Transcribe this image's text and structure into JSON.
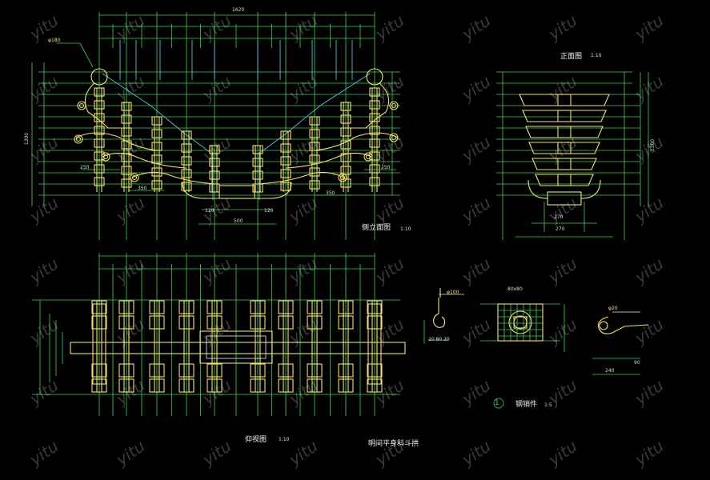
{
  "colors": {
    "background": "#000000",
    "dimension": "#39d353",
    "outline": "#f4e36a",
    "cyan": "#4fc6e0",
    "white_text": "#f2f2f2"
  },
  "labels": {
    "side_elevation_title": "侧立面图",
    "side_elevation_scale": "1:10",
    "front_elevation_title": "正面图",
    "front_elevation_scale": "1:10",
    "plan_title": "仰视图",
    "plan_scale": "1:10",
    "drawing_title": "明间平身科斗拱",
    "detail_title": "钢销件",
    "detail_scale": "1:5",
    "detail_marker": "1",
    "dia_180": "φ180",
    "dia_100": "φ100",
    "dia_20": "φ20",
    "dim_top_total": "1620",
    "dim_side_height": "1300",
    "dim_front_height": "1300",
    "dim_250": "250",
    "dim_350": "350",
    "dim_120": "120",
    "dim_500": "500",
    "dim_270": "270",
    "dim_90": "90",
    "dim_240": "240",
    "dim_80x80": "80x80",
    "dim_20_80_20": "20 80 20"
  },
  "watermark": "yitu"
}
